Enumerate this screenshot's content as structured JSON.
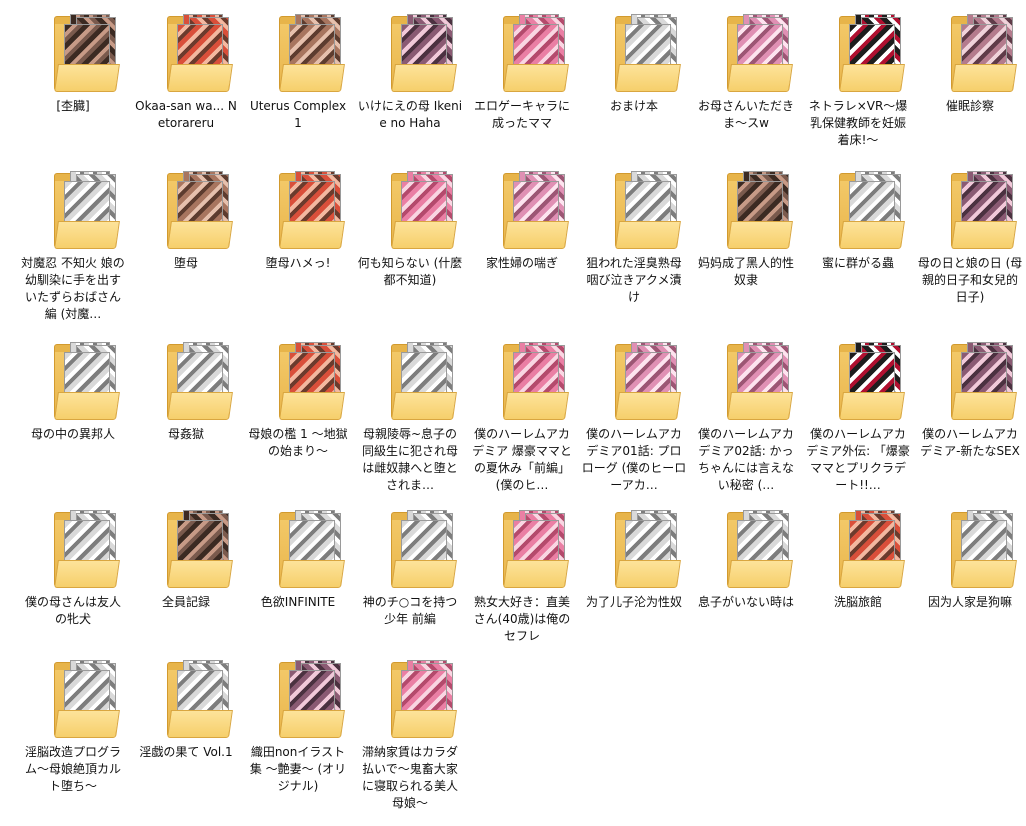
{
  "folders": [
    {
      "name": "[杢臓]",
      "style": "a"
    },
    {
      "name": "Okaa-san wa... Netorareru",
      "style": "b"
    },
    {
      "name": "Uterus Complex 1",
      "style": "c"
    },
    {
      "name": "いけにえの母 Ikenie no Haha",
      "style": "d"
    },
    {
      "name": "エロゲーキャラに成ったママ",
      "style": "e"
    },
    {
      "name": "おまけ本",
      "style": "f"
    },
    {
      "name": "お母さんいただきま～スw",
      "style": "g"
    },
    {
      "name": "ネトラレ×VR～爆乳保健教師を妊娠着床!～",
      "style": "h"
    },
    {
      "name": "催眠診察",
      "style": "i"
    },
    {
      "name": "対魔忍 不知火 娘の幼馴染に手を出すいたずらおばさん編 (対魔…",
      "style": "f"
    },
    {
      "name": "堕母",
      "style": "c"
    },
    {
      "name": "堕母ハメっ!",
      "style": "b"
    },
    {
      "name": "何も知らない (什麼都不知道)",
      "style": "e"
    },
    {
      "name": "家性婦の喘ぎ",
      "style": "g"
    },
    {
      "name": "狙われた淫臭熟母 咽び泣きアクメ漬け",
      "style": "f"
    },
    {
      "name": "妈妈成了黑人的性奴隶",
      "style": "a"
    },
    {
      "name": "蜜に群がる蟲",
      "style": "f"
    },
    {
      "name": "母の日と娘の日 (母親的日子和女兒的日子)",
      "style": "d"
    },
    {
      "name": "母の中の異邦人",
      "style": "f"
    },
    {
      "name": "母姦獄",
      "style": "f"
    },
    {
      "name": "母娘の檻 1 ～地獄の始まり～",
      "style": "b"
    },
    {
      "name": "母親陵辱~息子の同級生に犯され母は雌奴隷へと堕とされま…",
      "style": "f"
    },
    {
      "name": "僕のハーレムアカデミア 爆豪ママとの夏休み「前編」 (僕のヒ…",
      "style": "e"
    },
    {
      "name": "僕のハーレムアカデミア01話: プロローグ (僕のヒーローアカ…",
      "style": "g"
    },
    {
      "name": "僕のハーレムアカデミア02話: かっちゃんには言えない秘密 (…",
      "style": "g"
    },
    {
      "name": "僕のハーレムアカデミア外伝: 「爆豪ママとプリクラデート!!…",
      "style": "h"
    },
    {
      "name": "僕のハーレムアカデミア-新たなSEX",
      "style": "d"
    },
    {
      "name": "僕の母さんは友人の牝犬",
      "style": "f"
    },
    {
      "name": "全員記録",
      "style": "a"
    },
    {
      "name": "色欲INFINITE",
      "style": "f"
    },
    {
      "name": "神のチ○コを持つ少年 前編",
      "style": "f"
    },
    {
      "name": "熟女大好き：直美さん(40歳)は俺のセフレ",
      "style": "e"
    },
    {
      "name": "为了儿子沦为性奴",
      "style": "f"
    },
    {
      "name": "息子がいない時は",
      "style": "f"
    },
    {
      "name": "洗脳旅館",
      "style": "b"
    },
    {
      "name": "因为人家是狗嘛",
      "style": "f"
    },
    {
      "name": "淫脳改造プログラム～母娘絶頂カルト堕ち～",
      "style": "f"
    },
    {
      "name": "淫戯の果て Vol.1",
      "style": "f"
    },
    {
      "name": "織田nonイラスト集 ～艶妻～ (オリジナル)",
      "style": "d"
    },
    {
      "name": "滞納家賃はカラダ払いで～鬼畜大家に寝取られる美人母娘～",
      "style": "e"
    }
  ]
}
